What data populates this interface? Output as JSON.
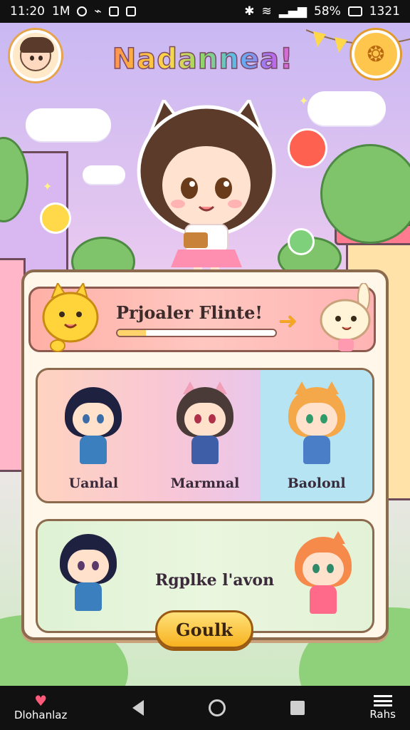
{
  "status_bar": {
    "time": "11:20",
    "label": "1M",
    "battery": "58%",
    "clock_right": "1321"
  },
  "header": {
    "title": "Nadannea!"
  },
  "promo": {
    "text": "Prjoaler Flinte!",
    "progress": 0.18
  },
  "characters": [
    {
      "label": "Uanlal"
    },
    {
      "label": "Marmnal"
    },
    {
      "label": "Baolonl"
    }
  ],
  "bottom_card": {
    "text": "Rgplke l'avon",
    "button_label": "Goulk"
  },
  "navbar": {
    "left_label": "Dlohanlaz",
    "right_label": "Rahs"
  },
  "colors": {
    "accent": "#f7b21f",
    "panel_border": "#8c6a4e",
    "promo_bg": "#ffb4b4"
  }
}
